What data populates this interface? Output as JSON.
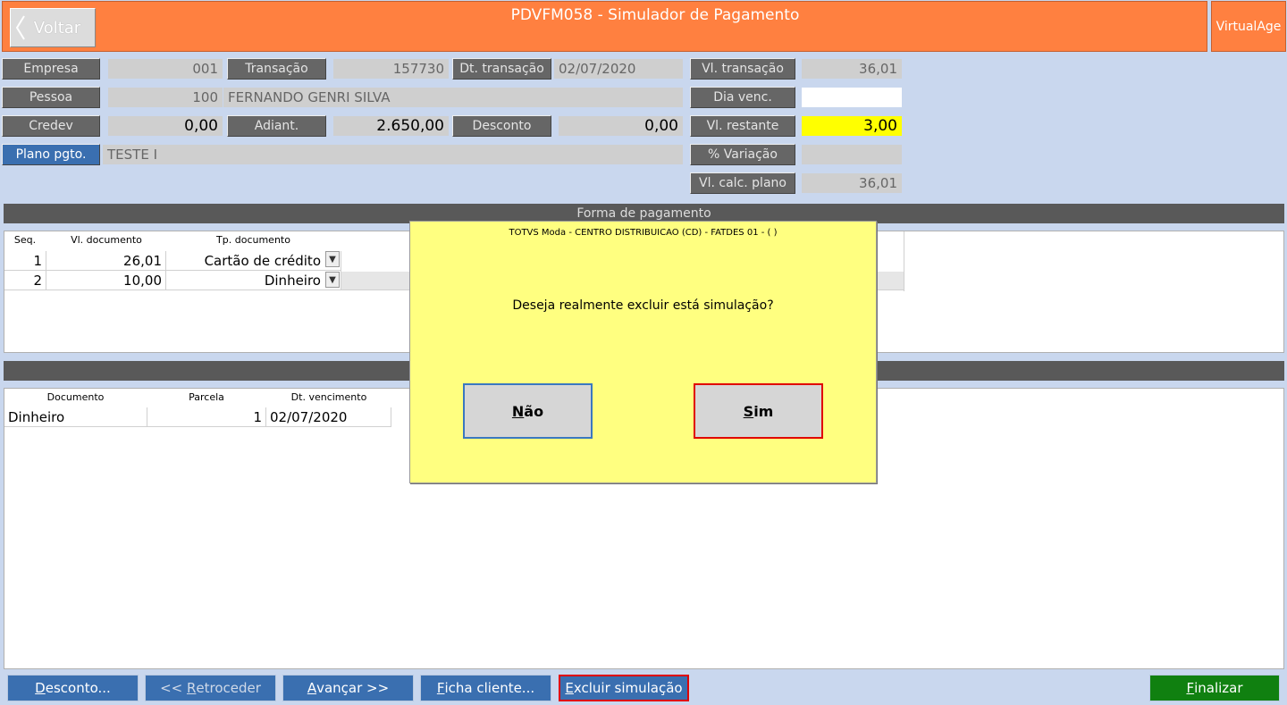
{
  "header": {
    "back_label": "Voltar",
    "title": "PDVFM058 - Simulador de Pagamento",
    "brand": "VirtualAge"
  },
  "form": {
    "empresa": {
      "label": "Empresa",
      "value": "001"
    },
    "transacao": {
      "label": "Transação",
      "value": "157730"
    },
    "dt_transacao": {
      "label": "Dt. transação",
      "value": "02/07/2020"
    },
    "vl_transacao": {
      "label": "Vl. transação",
      "value": "36,01"
    },
    "pessoa": {
      "label": "Pessoa",
      "code": "100",
      "name": "FERNANDO GENRI SILVA"
    },
    "dia_venc": {
      "label": "Dia venc.",
      "value": ""
    },
    "credev": {
      "label": "Credev",
      "value": "0,00"
    },
    "adiant": {
      "label": "Adiant.",
      "value": "2.650,00"
    },
    "desconto": {
      "label": "Desconto",
      "value": "0,00"
    },
    "vl_restante": {
      "label": "Vl. restante",
      "value": "3,00"
    },
    "plano_pgto": {
      "label": "Plano pgto.",
      "value": "TESTE I"
    },
    "variacao": {
      "label": "% Variação",
      "value": ""
    },
    "vl_calc_plano": {
      "label": "Vl. calc. plano",
      "value": "36,01"
    }
  },
  "payment_grid": {
    "title": "Forma de pagamento",
    "headers": [
      "Seq.",
      "Vl. documento",
      "Tp. documento"
    ],
    "rows": [
      {
        "seq": "1",
        "valor": "26,01",
        "tipo": "Cartão de crédito"
      },
      {
        "seq": "2",
        "valor": "10,00",
        "tipo": "Dinheiro"
      }
    ]
  },
  "installments_grid": {
    "headers": [
      "Documento",
      "Parcela",
      "Dt. vencimento"
    ],
    "rows": [
      {
        "documento": "Dinheiro",
        "parcela": "1",
        "vencimento": "02/07/2020"
      }
    ]
  },
  "dialog": {
    "title": "TOTVS Moda - CENTRO DISTRIBUICAO (CD) - FATDES 01 - (  )",
    "message": "Deseja realmente excluir está simulação?",
    "no_key": "N",
    "no_rest": "ão",
    "yes_key": "S",
    "yes_rest": "im"
  },
  "footer": {
    "desconto": {
      "key": "D",
      "rest": "esconto..."
    },
    "retroceder": {
      "pre": "<< ",
      "key": "R",
      "rest": "etroceder"
    },
    "avancar": {
      "key": "A",
      "rest": "vançar >>"
    },
    "ficha": {
      "key": "F",
      "rest": "icha cliente..."
    },
    "excluir": {
      "key": "E",
      "rest": "xcluir simulação"
    },
    "finalizar": {
      "key": "F",
      "rest": "inalizar"
    }
  },
  "colors": {
    "header": "#ff8040",
    "background": "#c9d7ee",
    "dialog": "#ffff80",
    "highlight": "#ffff00",
    "finalize": "#108010",
    "danger_border": "#e00000"
  }
}
